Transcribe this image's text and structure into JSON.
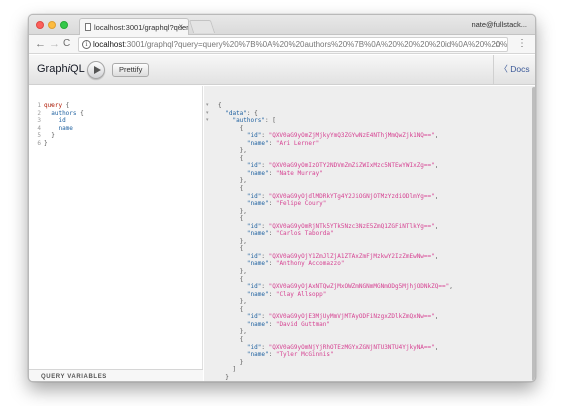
{
  "browser": {
    "tab_title": "localhost:3001/graphql?query",
    "tab_close": "×",
    "profile": "nate@fullstack...",
    "back_label": "←",
    "forward_label": "→",
    "reload_label": "C",
    "url_host": "localhost",
    "url_path": ":3001/graphql?query=query%20%7B%0A%20%20authors%20%7B%0A%20%20%20%20id%0A%20%20%20%20name...",
    "star_label": "☆",
    "menu_label": "⋮"
  },
  "graphiql": {
    "title_prefix": "Graph",
    "title_italic": "i",
    "title_suffix": "QL",
    "prettify_label": "Prettify",
    "docs_label": "〈 Docs",
    "query_variables_label": "QUERY VARIABLES",
    "line_numbers": "1\n2\n3\n4\n5\n6",
    "query": {
      "keyword": "query",
      "field": "authors",
      "sub_fields": [
        "id",
        "name"
      ]
    }
  },
  "result": {
    "root_key": "data",
    "list_key": "authors",
    "authors": [
      {
        "id": "QXV0aG9yOmZjMjkyYmQ3ZGYwNzE4NThjMmQwZjk1NQ==",
        "name": "Ari Lerner"
      },
      {
        "id": "QXV0aG9yOmIzOTY2NDVmZmZiZWIxMzc5NTEwYWIxZg==",
        "name": "Nate Murray"
      },
      {
        "id": "QXV0aG9yOjdlMDRkYTg4Y2JiOGNjOTMzYzdiODlmYg==",
        "name": "Felipe Coury"
      },
      {
        "id": "QXV0aG9yOmRjNTk5YTk5Nzc3NzE5ZmQ1ZGFiNTlkYg==",
        "name": "Carlos Taborda"
      },
      {
        "id": "QXV0aG9yOjY1ZmJlZjA1ZTAxZmFjMzkwY2IzZmEwNw==",
        "name": "Anthony Accomazzo"
      },
      {
        "id": "QXV0aG9yOjAxNTQwZjMxOWZmNGNmMGNmODg5MjhjODNkZQ==",
        "name": "Clay Allsopp"
      },
      {
        "id": "QXV0aG9yOjE3MjUyMmVjMTAyODFiNzgxZDlkZmQxNw==",
        "name": "David Guttman"
      },
      {
        "id": "QXV0aG9yOmNjYjRhOTEzMGYxZGNjNTU3NTU4YjkyNA==",
        "name": "Tyler McGinnis"
      }
    ]
  },
  "colors": {
    "keyword": "#b11a04",
    "field": "#1f61a0",
    "string": "#d64292",
    "docs_link": "#3b5998"
  }
}
